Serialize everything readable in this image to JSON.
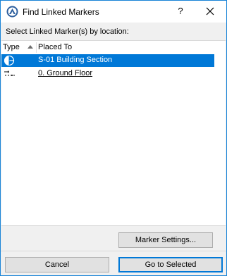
{
  "window": {
    "title": "Find Linked Markers",
    "help_label": "?"
  },
  "instruction": "Select Linked Marker(s) by location:",
  "list": {
    "columns": {
      "type": "Type",
      "placed_to": "Placed To"
    },
    "rows": [
      {
        "icon": "section-marker-icon",
        "label": "S-01 Building Section",
        "selected": true
      },
      {
        "icon": "floor-marker-icon",
        "label": "0. Ground Floor",
        "selected": false
      }
    ]
  },
  "buttons": {
    "marker_settings": "Marker Settings...",
    "cancel": "Cancel",
    "go_to_selected": "Go to Selected"
  },
  "colors": {
    "selection": "#0078d7",
    "window_border": "#1883d7"
  }
}
